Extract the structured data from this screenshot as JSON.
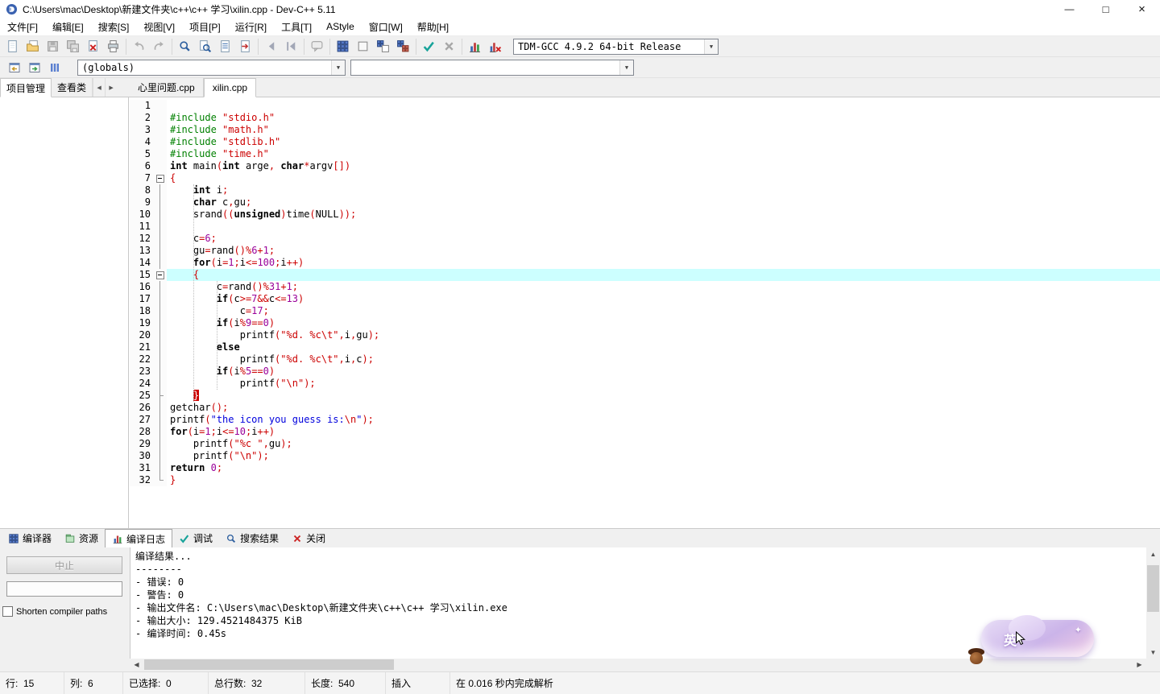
{
  "window": {
    "title": "C:\\Users\\mac\\Desktop\\新建文件夹\\c++\\c++ 学习\\xilin.cpp - Dev-C++ 5.11",
    "controls": {
      "minimize": "—",
      "maximize": "□",
      "close": "×"
    }
  },
  "menu": {
    "items": [
      {
        "name": "menu-file",
        "label": "文件[F]"
      },
      {
        "name": "menu-edit",
        "label": "编辑[E]"
      },
      {
        "name": "menu-search",
        "label": "搜索[S]"
      },
      {
        "name": "menu-view",
        "label": "视图[V]"
      },
      {
        "name": "menu-project",
        "label": "项目[P]"
      },
      {
        "name": "menu-run",
        "label": "运行[R]"
      },
      {
        "name": "menu-tools",
        "label": "工具[T]"
      },
      {
        "name": "menu-astyle",
        "label": "AStyle"
      },
      {
        "name": "menu-window",
        "label": "窗口[W]"
      },
      {
        "name": "menu-help",
        "label": "帮助[H]"
      }
    ]
  },
  "toolbar": {
    "compiler_combo": "TDM-GCC 4.9.2 64-bit Release",
    "buttons": [
      {
        "name": "new-source",
        "icon": "page",
        "disabled": false
      },
      {
        "name": "open-file",
        "icon": "folder",
        "disabled": false
      },
      {
        "name": "save",
        "icon": "floppy",
        "disabled": true
      },
      {
        "name": "save-all",
        "icon": "floppy2",
        "disabled": true
      },
      {
        "name": "close-file",
        "icon": "pagex",
        "disabled": false
      },
      {
        "name": "print",
        "icon": "printer",
        "disabled": false
      },
      {
        "sep": true
      },
      {
        "name": "undo",
        "icon": "undo",
        "disabled": true
      },
      {
        "name": "redo",
        "icon": "redo",
        "disabled": true
      },
      {
        "sep": true
      },
      {
        "name": "find",
        "icon": "mag",
        "disabled": false
      },
      {
        "name": "find-in-files",
        "icon": "magpage",
        "disabled": false
      },
      {
        "name": "replace",
        "icon": "pagelines",
        "disabled": false
      },
      {
        "name": "goto-line",
        "icon": "pagegoto",
        "disabled": false
      },
      {
        "sep": true
      },
      {
        "name": "go-back",
        "icon": "arrl",
        "disabled": true
      },
      {
        "name": "go-forward",
        "icon": "arrlb",
        "disabled": true
      },
      {
        "sep": true
      },
      {
        "name": "comment",
        "icon": "bubble",
        "disabled": true
      },
      {
        "sep": true
      },
      {
        "name": "compile",
        "icon": "grid",
        "disabled": false
      },
      {
        "name": "run",
        "icon": "square",
        "disabled": false
      },
      {
        "name": "compile-run",
        "icon": "gridsq",
        "disabled": false
      },
      {
        "name": "rebuild-all",
        "icon": "grid2",
        "disabled": false
      },
      {
        "sep": true
      },
      {
        "name": "debug",
        "icon": "check",
        "disabled": false
      },
      {
        "name": "abort-compilation",
        "icon": "crossg",
        "disabled": true
      },
      {
        "sep": true
      },
      {
        "name": "profile",
        "icon": "chart",
        "disabled": false
      },
      {
        "name": "delete-profiling",
        "icon": "chartx",
        "disabled": false
      }
    ]
  },
  "toolbar2": {
    "globals_combo": "(globals)",
    "members_combo": "",
    "buttons": [
      {
        "name": "prev-editor",
        "icon": "winout"
      },
      {
        "name": "next-editor",
        "icon": "winin"
      },
      {
        "name": "editor-list",
        "icon": "columns"
      }
    ]
  },
  "left_tabs": [
    {
      "name": "tab-project-manager",
      "label": "项目管理",
      "active": true
    },
    {
      "name": "tab-class-viewer",
      "label": "查看类",
      "active": false
    }
  ],
  "tab_nav": {
    "prev": "◀",
    "next": "▶"
  },
  "editor_tabs": [
    {
      "name": "editor-tab-xinliwenti",
      "label": "心里问题.cpp",
      "active": false
    },
    {
      "name": "editor-tab-xilin",
      "label": "xilin.cpp",
      "active": true
    }
  ],
  "code": {
    "highlight_line": 15,
    "lines": [
      {
        "n": 1,
        "f": "",
        "t": []
      },
      {
        "n": 2,
        "f": "",
        "t": [
          [
            "g",
            "#include "
          ],
          [
            "r",
            "\"stdio.h\""
          ]
        ]
      },
      {
        "n": 3,
        "f": "",
        "t": [
          [
            "g",
            "#include "
          ],
          [
            "r",
            "\"math.h\""
          ]
        ]
      },
      {
        "n": 4,
        "f": "",
        "t": [
          [
            "g",
            "#include "
          ],
          [
            "r",
            "\"stdlib.h\""
          ]
        ]
      },
      {
        "n": 5,
        "f": "",
        "t": [
          [
            "g",
            "#include "
          ],
          [
            "r",
            "\"time.h\""
          ]
        ]
      },
      {
        "n": 6,
        "f": "",
        "t": [
          [
            "k",
            "int"
          ],
          [
            "p",
            " main"
          ],
          [
            "s",
            "("
          ],
          [
            "k",
            "int"
          ],
          [
            "p",
            " arge"
          ],
          [
            "s",
            ","
          ],
          [
            "p",
            " "
          ],
          [
            "k",
            "char"
          ],
          [
            "s",
            "*"
          ],
          [
            "p",
            "argv"
          ],
          [
            "s",
            "[])"
          ]
        ]
      },
      {
        "n": 7,
        "f": "box",
        "t": [
          [
            "s",
            "{"
          ]
        ]
      },
      {
        "n": 8,
        "f": "line",
        "t": [
          [
            "p",
            "    "
          ],
          [
            "k",
            "int"
          ],
          [
            "p",
            " i"
          ],
          [
            "s",
            ";"
          ]
        ]
      },
      {
        "n": 9,
        "f": "line",
        "t": [
          [
            "p",
            "    "
          ],
          [
            "k",
            "char"
          ],
          [
            "p",
            " c"
          ],
          [
            "s",
            ","
          ],
          [
            "p",
            "gu"
          ],
          [
            "s",
            ";"
          ]
        ]
      },
      {
        "n": 10,
        "f": "line",
        "t": [
          [
            "p",
            "    srand"
          ],
          [
            "s",
            "(("
          ],
          [
            "k",
            "unsigned"
          ],
          [
            "s",
            ")"
          ],
          [
            "p",
            "time"
          ],
          [
            "s",
            "("
          ],
          [
            "p",
            "NULL"
          ],
          [
            "s",
            "));"
          ]
        ]
      },
      {
        "n": 11,
        "f": "line",
        "t": []
      },
      {
        "n": 12,
        "f": "line",
        "t": [
          [
            "p",
            "    c"
          ],
          [
            "s",
            "="
          ],
          [
            "n",
            "6"
          ],
          [
            "s",
            ";"
          ]
        ]
      },
      {
        "n": 13,
        "f": "line",
        "t": [
          [
            "p",
            "    gu"
          ],
          [
            "s",
            "="
          ],
          [
            "p",
            "rand"
          ],
          [
            "s",
            "()%"
          ],
          [
            "n",
            "6"
          ],
          [
            "s",
            "+"
          ],
          [
            "n",
            "1"
          ],
          [
            "s",
            ";"
          ]
        ]
      },
      {
        "n": 14,
        "f": "line",
        "t": [
          [
            "p",
            "    "
          ],
          [
            "k",
            "for"
          ],
          [
            "s",
            "("
          ],
          [
            "p",
            "i"
          ],
          [
            "s",
            "="
          ],
          [
            "n",
            "1"
          ],
          [
            "s",
            ";"
          ],
          [
            "p",
            "i"
          ],
          [
            "s",
            "<="
          ],
          [
            "n",
            "100"
          ],
          [
            "s",
            ";"
          ],
          [
            "p",
            "i"
          ],
          [
            "s",
            "++)"
          ]
        ]
      },
      {
        "n": 15,
        "f": "box",
        "hl": true,
        "t": [
          [
            "p",
            "    "
          ],
          [
            "s",
            "{"
          ]
        ]
      },
      {
        "n": 16,
        "f": "line",
        "t": [
          [
            "p",
            "        c"
          ],
          [
            "s",
            "="
          ],
          [
            "p",
            "rand"
          ],
          [
            "s",
            "()%"
          ],
          [
            "n",
            "31"
          ],
          [
            "s",
            "+"
          ],
          [
            "n",
            "1"
          ],
          [
            "s",
            ";"
          ]
        ]
      },
      {
        "n": 17,
        "f": "line",
        "t": [
          [
            "p",
            "        "
          ],
          [
            "k",
            "if"
          ],
          [
            "s",
            "("
          ],
          [
            "p",
            "c"
          ],
          [
            "s",
            ">="
          ],
          [
            "n",
            "7"
          ],
          [
            "s",
            "&&"
          ],
          [
            "p",
            "c"
          ],
          [
            "s",
            "<="
          ],
          [
            "n",
            "13"
          ],
          [
            "s",
            ")"
          ]
        ]
      },
      {
        "n": 18,
        "f": "line",
        "t": [
          [
            "p",
            "            c"
          ],
          [
            "s",
            "="
          ],
          [
            "n",
            "17"
          ],
          [
            "s",
            ";"
          ]
        ]
      },
      {
        "n": 19,
        "f": "line",
        "t": [
          [
            "p",
            "        "
          ],
          [
            "k",
            "if"
          ],
          [
            "s",
            "("
          ],
          [
            "p",
            "i"
          ],
          [
            "s",
            "%"
          ],
          [
            "n",
            "9"
          ],
          [
            "s",
            "=="
          ],
          [
            "n",
            "0"
          ],
          [
            "s",
            ")"
          ]
        ]
      },
      {
        "n": 20,
        "f": "line",
        "t": [
          [
            "p",
            "            printf"
          ],
          [
            "s",
            "("
          ],
          [
            "r",
            "\"%d. %c\\t\""
          ],
          [
            "s",
            ","
          ],
          [
            "p",
            "i"
          ],
          [
            "s",
            ","
          ],
          [
            "p",
            "gu"
          ],
          [
            "s",
            ");"
          ]
        ]
      },
      {
        "n": 21,
        "f": "line",
        "t": [
          [
            "p",
            "        "
          ],
          [
            "k",
            "else"
          ]
        ]
      },
      {
        "n": 22,
        "f": "line",
        "t": [
          [
            "p",
            "            printf"
          ],
          [
            "s",
            "("
          ],
          [
            "r",
            "\"%d. %c\\t\""
          ],
          [
            "s",
            ","
          ],
          [
            "p",
            "i"
          ],
          [
            "s",
            ","
          ],
          [
            "p",
            "c"
          ],
          [
            "s",
            ");"
          ]
        ]
      },
      {
        "n": 23,
        "f": "line",
        "t": [
          [
            "p",
            "        "
          ],
          [
            "k",
            "if"
          ],
          [
            "s",
            "("
          ],
          [
            "p",
            "i"
          ],
          [
            "s",
            "%"
          ],
          [
            "n",
            "5"
          ],
          [
            "s",
            "=="
          ],
          [
            "n",
            "0"
          ],
          [
            "s",
            ")"
          ]
        ]
      },
      {
        "n": 24,
        "f": "line",
        "t": [
          [
            "p",
            "            printf"
          ],
          [
            "s",
            "("
          ],
          [
            "r",
            "\"\\n\""
          ],
          [
            "s",
            ");"
          ]
        ]
      },
      {
        "n": 25,
        "f": "tee",
        "t": [
          [
            "p",
            "    "
          ],
          [
            "m",
            "}"
          ]
        ]
      },
      {
        "n": 26,
        "f": "line",
        "t": [
          [
            "p",
            "getchar"
          ],
          [
            "s",
            "();"
          ]
        ]
      },
      {
        "n": 27,
        "f": "line",
        "t": [
          [
            "p",
            "printf"
          ],
          [
            "s",
            "("
          ],
          [
            "b",
            "\"the icon you guess is:"
          ],
          [
            "r",
            "\\n"
          ],
          [
            "b",
            "\""
          ],
          [
            "s",
            ");"
          ]
        ]
      },
      {
        "n": 28,
        "f": "line",
        "t": [
          [
            "k",
            "for"
          ],
          [
            "s",
            "("
          ],
          [
            "p",
            "i"
          ],
          [
            "s",
            "="
          ],
          [
            "n",
            "1"
          ],
          [
            "s",
            ";"
          ],
          [
            "p",
            "i"
          ],
          [
            "s",
            "<="
          ],
          [
            "n",
            "10"
          ],
          [
            "s",
            ";"
          ],
          [
            "p",
            "i"
          ],
          [
            "s",
            "++)"
          ]
        ]
      },
      {
        "n": 29,
        "f": "line",
        "t": [
          [
            "p",
            "    printf"
          ],
          [
            "s",
            "("
          ],
          [
            "r",
            "\"%c \""
          ],
          [
            "s",
            ","
          ],
          [
            "p",
            "gu"
          ],
          [
            "s",
            ");"
          ]
        ]
      },
      {
        "n": 30,
        "f": "line",
        "t": [
          [
            "p",
            "    printf"
          ],
          [
            "s",
            "("
          ],
          [
            "r",
            "\"\\n\""
          ],
          [
            "s",
            ");"
          ]
        ]
      },
      {
        "n": 31,
        "f": "line",
        "t": [
          [
            "k",
            "return"
          ],
          [
            "p",
            " "
          ],
          [
            "n",
            "0"
          ],
          [
            "s",
            ";"
          ]
        ]
      },
      {
        "n": 32,
        "f": "corner",
        "t": [
          [
            "s",
            "}"
          ]
        ]
      }
    ]
  },
  "bottom_tabs": [
    {
      "name": "tab-compiler",
      "label": "编译器",
      "icon": "grid",
      "active": false
    },
    {
      "name": "tab-resources",
      "label": "资源",
      "icon": "resource",
      "active": false
    },
    {
      "name": "tab-compile-log",
      "label": "编译日志",
      "icon": "chart",
      "active": true
    },
    {
      "name": "tab-debug",
      "label": "调试",
      "icon": "check",
      "active": false
    },
    {
      "name": "tab-search-results",
      "label": "搜索结果",
      "icon": "mag",
      "active": false
    },
    {
      "name": "tab-close",
      "label": "关闭",
      "icon": "crossr",
      "active": false
    }
  ],
  "compile_panel": {
    "abort_label": "中止",
    "shorten_compiler_paths_label": "Shorten compiler paths",
    "log_lines": [
      "编译结果...",
      "--------",
      "- 错误: 0",
      "- 警告: 0",
      "- 输出文件名: C:\\Users\\mac\\Desktop\\新建文件夹\\c++\\c++ 学习\\xilin.exe",
      "- 输出大小: 129.4521484375 KiB",
      "- 编译时间: 0.45s"
    ]
  },
  "status_bar": {
    "items": [
      {
        "name": "status-line",
        "text": "行:  15"
      },
      {
        "name": "status-column",
        "text": "列:  6"
      },
      {
        "name": "status-selected",
        "text": "已选择:  0"
      },
      {
        "name": "status-total-lines",
        "text": "总行数:  32"
      },
      {
        "name": "status-length",
        "text": "长度:  540"
      },
      {
        "name": "status-insert-mode",
        "text": "插入"
      },
      {
        "name": "status-parse-message",
        "text": "在 0.016 秒内完成解析"
      }
    ]
  },
  "ime_widget": {
    "text": "英",
    "spark": "✦"
  }
}
